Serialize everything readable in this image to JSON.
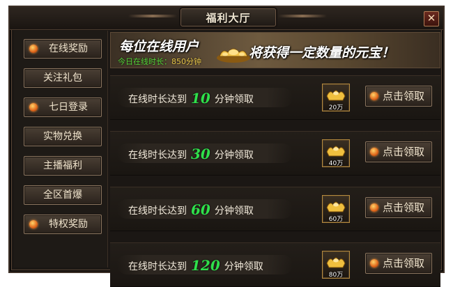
{
  "window": {
    "title": "福利大厅",
    "close_glyph": "✕"
  },
  "sidebar": {
    "items": [
      {
        "label": "在线奖励",
        "dot": true
      },
      {
        "label": "关注礼包",
        "dot": false
      },
      {
        "label": "七日登录",
        "dot": true
      },
      {
        "label": "实物兑换",
        "dot": false
      },
      {
        "label": "主播福利",
        "dot": false
      },
      {
        "label": "全区首爆",
        "dot": false
      },
      {
        "label": "特权奖励",
        "dot": true
      }
    ]
  },
  "banner": {
    "left": "每位在线用户",
    "right": "将获得一定数量的元宝！",
    "today_label": "今日在线时长：",
    "today_value": "850分钟"
  },
  "rewards": [
    {
      "prefix": "在线时长达到",
      "minutes": "10",
      "suffix": "分钟领取",
      "amount": "20万",
      "button": "点击领取"
    },
    {
      "prefix": "在线时长达到",
      "minutes": "30",
      "suffix": "分钟领取",
      "amount": "40万",
      "button": "点击领取"
    },
    {
      "prefix": "在线时长达到",
      "minutes": "60",
      "suffix": "分钟领取",
      "amount": "60万",
      "button": "点击领取"
    },
    {
      "prefix": "在线时长达到",
      "minutes": "120",
      "suffix": "分钟领取",
      "amount": "80万",
      "button": "点击领取"
    }
  ],
  "colors": {
    "accent_green": "#2fe04b",
    "gold": "#e8c64a",
    "dot_orange": "#e0661b"
  },
  "icons": {
    "close": "close-icon",
    "reward": "gold-ingot-icon",
    "banner": "gold-ingot-pile-icon",
    "dot": "orange-dot-icon"
  }
}
